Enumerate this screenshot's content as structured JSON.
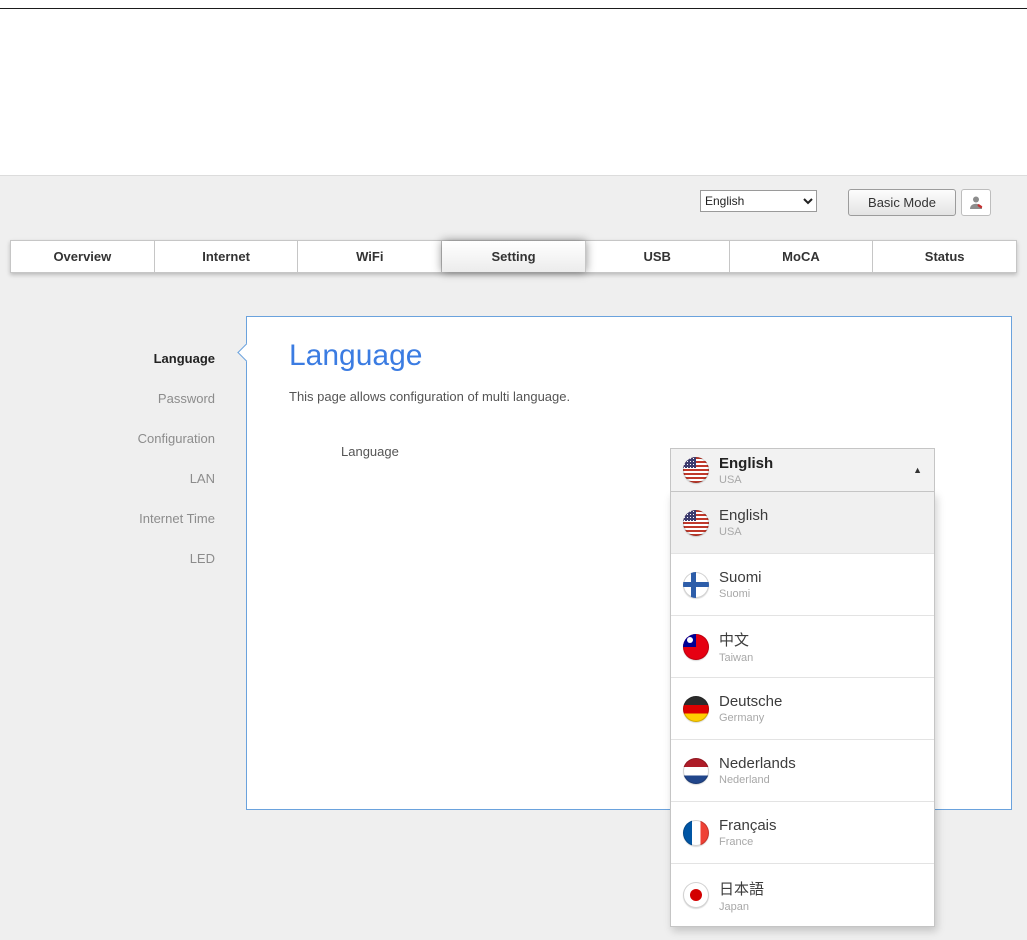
{
  "topbar": {
    "language_select": {
      "value": "English"
    },
    "basic_mode_button": "Basic Mode"
  },
  "tabs": [
    {
      "label": "Overview"
    },
    {
      "label": "Internet"
    },
    {
      "label": "WiFi"
    },
    {
      "label": "Setting"
    },
    {
      "label": "USB"
    },
    {
      "label": "MoCA"
    },
    {
      "label": "Status"
    }
  ],
  "sidebar": {
    "items": [
      {
        "label": "Language"
      },
      {
        "label": "Password"
      },
      {
        "label": "Configuration"
      },
      {
        "label": "LAN"
      },
      {
        "label": "Internet Time"
      },
      {
        "label": "LED"
      }
    ]
  },
  "content": {
    "title": "Language",
    "description": "This page allows configuration of multi language.",
    "field_label": "Language",
    "dropdown": {
      "selected": {
        "label": "English",
        "sublabel": "USA",
        "flag": "usa"
      },
      "options": [
        {
          "label": "English",
          "sublabel": "USA",
          "flag": "usa"
        },
        {
          "label": "Suomi",
          "sublabel": "Suomi",
          "flag": "finland"
        },
        {
          "label": "中文",
          "sublabel": "Taiwan",
          "flag": "taiwan"
        },
        {
          "label": "Deutsche",
          "sublabel": "Germany",
          "flag": "germany"
        },
        {
          "label": "Nederlands",
          "sublabel": "Nederland",
          "flag": "netherlands"
        },
        {
          "label": "Français",
          "sublabel": "France",
          "flag": "france"
        },
        {
          "label": "日本語",
          "sublabel": "Japan",
          "flag": "japan"
        }
      ]
    }
  },
  "colors": {
    "accent_blue": "#3b7ce2",
    "panel_border_blue": "#6aa2dd",
    "panel_gray": "#efefef"
  }
}
